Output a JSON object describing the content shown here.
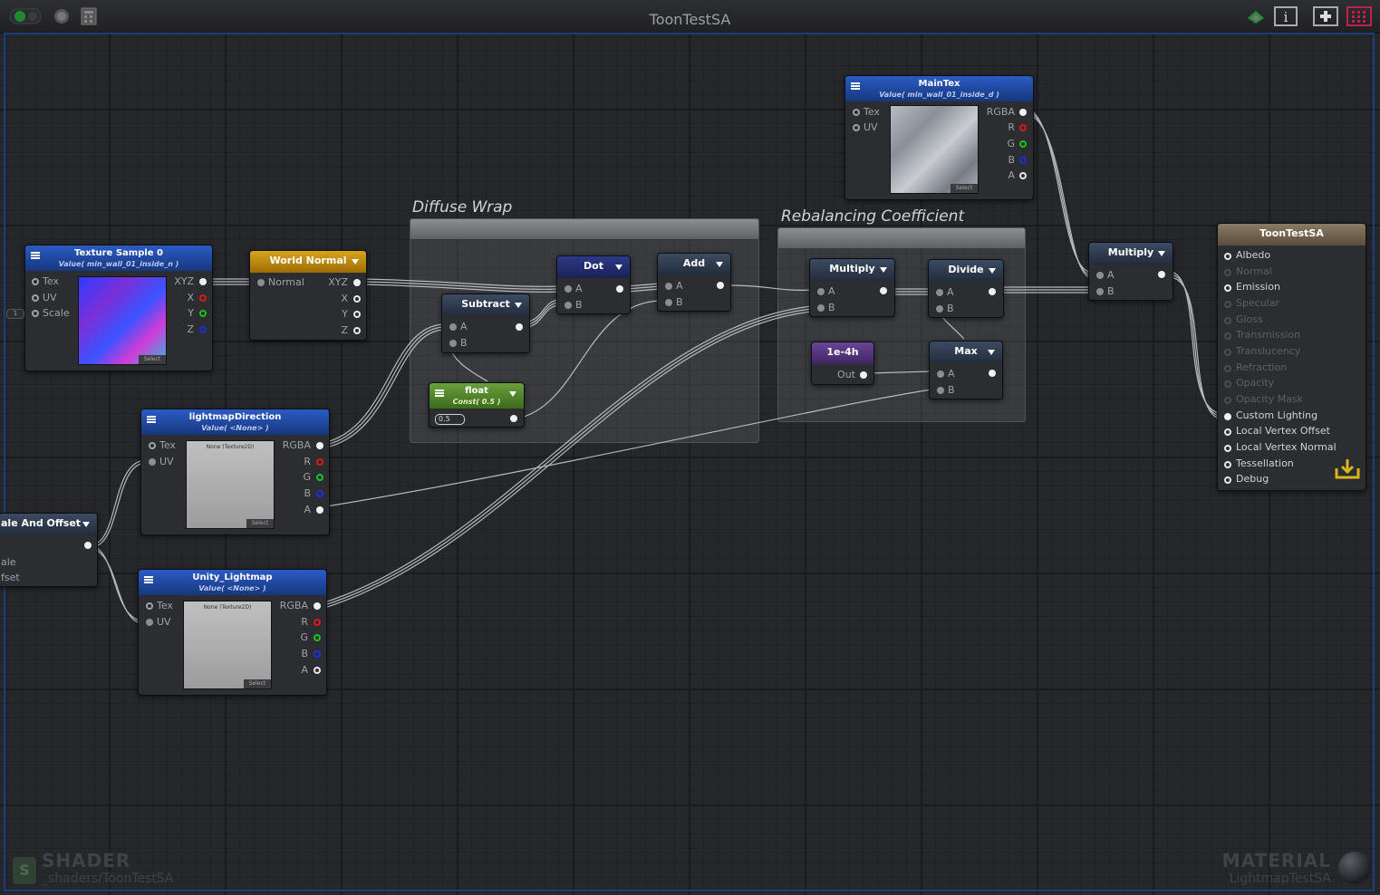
{
  "window": {
    "title": "ToonTestSA"
  },
  "groups": [
    {
      "title": "Diffuse Wrap"
    },
    {
      "title": "Rebalancing Coefficient"
    }
  ],
  "nodes": {
    "texture_sample0": {
      "title": "Texture Sample 0",
      "subtitle": "Value( min_wall_01_inside_n )",
      "inputs": [
        "Tex",
        "UV",
        "Scale"
      ],
      "outputs": [
        "XYZ",
        "X",
        "Y",
        "Z"
      ],
      "select": "Select",
      "scale_input": "1"
    },
    "world_normal": {
      "title": "World Normal",
      "inputs": [
        "Normal"
      ],
      "outputs": [
        "XYZ",
        "X",
        "Y",
        "Z"
      ]
    },
    "lightmap_direction": {
      "title": "lightmapDirection",
      "subtitle": "Value( <None> )",
      "inputs": [
        "Tex",
        "UV"
      ],
      "outputs": [
        "RGBA",
        "R",
        "G",
        "B",
        "A"
      ],
      "thumb_text": "None (Texture2D)",
      "select": "Select"
    },
    "scale_offset": {
      "title": "ale And Offset",
      "inputs": [
        "ale",
        "fset"
      ]
    },
    "unity_lightmap": {
      "title": "Unity_Lightmap",
      "subtitle": "Value( <None> )",
      "inputs": [
        "Tex",
        "UV"
      ],
      "outputs": [
        "RGBA",
        "R",
        "G",
        "B",
        "A"
      ],
      "thumb_text": "None (Texture2D)",
      "select": "Select"
    },
    "subtract": {
      "title": "Subtract",
      "inputs": [
        "A",
        "B"
      ]
    },
    "dot": {
      "title": "Dot",
      "inputs": [
        "A",
        "B"
      ]
    },
    "add": {
      "title": "Add",
      "inputs": [
        "A",
        "B"
      ]
    },
    "float": {
      "title": "float",
      "subtitle": "Const( 0.5 )",
      "value": "0.5"
    },
    "multiply1": {
      "title": "Multiply",
      "inputs": [
        "A",
        "B"
      ]
    },
    "divide": {
      "title": "Divide",
      "inputs": [
        "A",
        "B"
      ]
    },
    "const1e4": {
      "title": "1e-4h",
      "outputs": [
        "Out"
      ]
    },
    "max": {
      "title": "Max",
      "inputs": [
        "A",
        "B"
      ]
    },
    "maintex": {
      "title": "MainTex",
      "subtitle": "Value( min_wall_01_inside_d )",
      "inputs": [
        "Tex",
        "UV"
      ],
      "outputs": [
        "RGBA",
        "R",
        "G",
        "B",
        "A"
      ],
      "select": "Select"
    },
    "multiply2": {
      "title": "Multiply",
      "inputs": [
        "A",
        "B"
      ]
    },
    "output": {
      "title": "ToonTestSA",
      "inputs": [
        {
          "label": "Albedo",
          "active": true
        },
        {
          "label": "Normal",
          "active": false
        },
        {
          "label": "Emission",
          "active": true
        },
        {
          "label": "Specular",
          "active": false
        },
        {
          "label": "Gloss",
          "active": false
        },
        {
          "label": "Transmission",
          "active": false
        },
        {
          "label": "Translucency",
          "active": false
        },
        {
          "label": "Refraction",
          "active": false
        },
        {
          "label": "Opacity",
          "active": false
        },
        {
          "label": "Opacity Mask",
          "active": false
        },
        {
          "label": "Custom Lighting",
          "active": true
        },
        {
          "label": "Local Vertex Offset",
          "active": true
        },
        {
          "label": "Local Vertex Normal",
          "active": true
        },
        {
          "label": "Tessellation",
          "active": true
        },
        {
          "label": "Debug",
          "active": true
        }
      ]
    }
  },
  "footer": {
    "shader_label": "SHADER",
    "shader_path": "_shaders/ToonTestSA",
    "material_label": "MATERIAL",
    "material_name": "LightmapTestSA"
  },
  "colors": {
    "canvas": "#25272a",
    "frame": "#1b3e7a",
    "node_blue": "#2a5bc4",
    "node_gold": "#d8a51b",
    "node_green": "#6aa03c",
    "node_purple": "#6a4596",
    "output_header": "#8a7a64"
  },
  "icons": [
    "live-toggle-icon",
    "record-icon",
    "calculator-icon",
    "share-icon",
    "info-icon",
    "add-node-icon",
    "grid-icon",
    "download-icon"
  ]
}
